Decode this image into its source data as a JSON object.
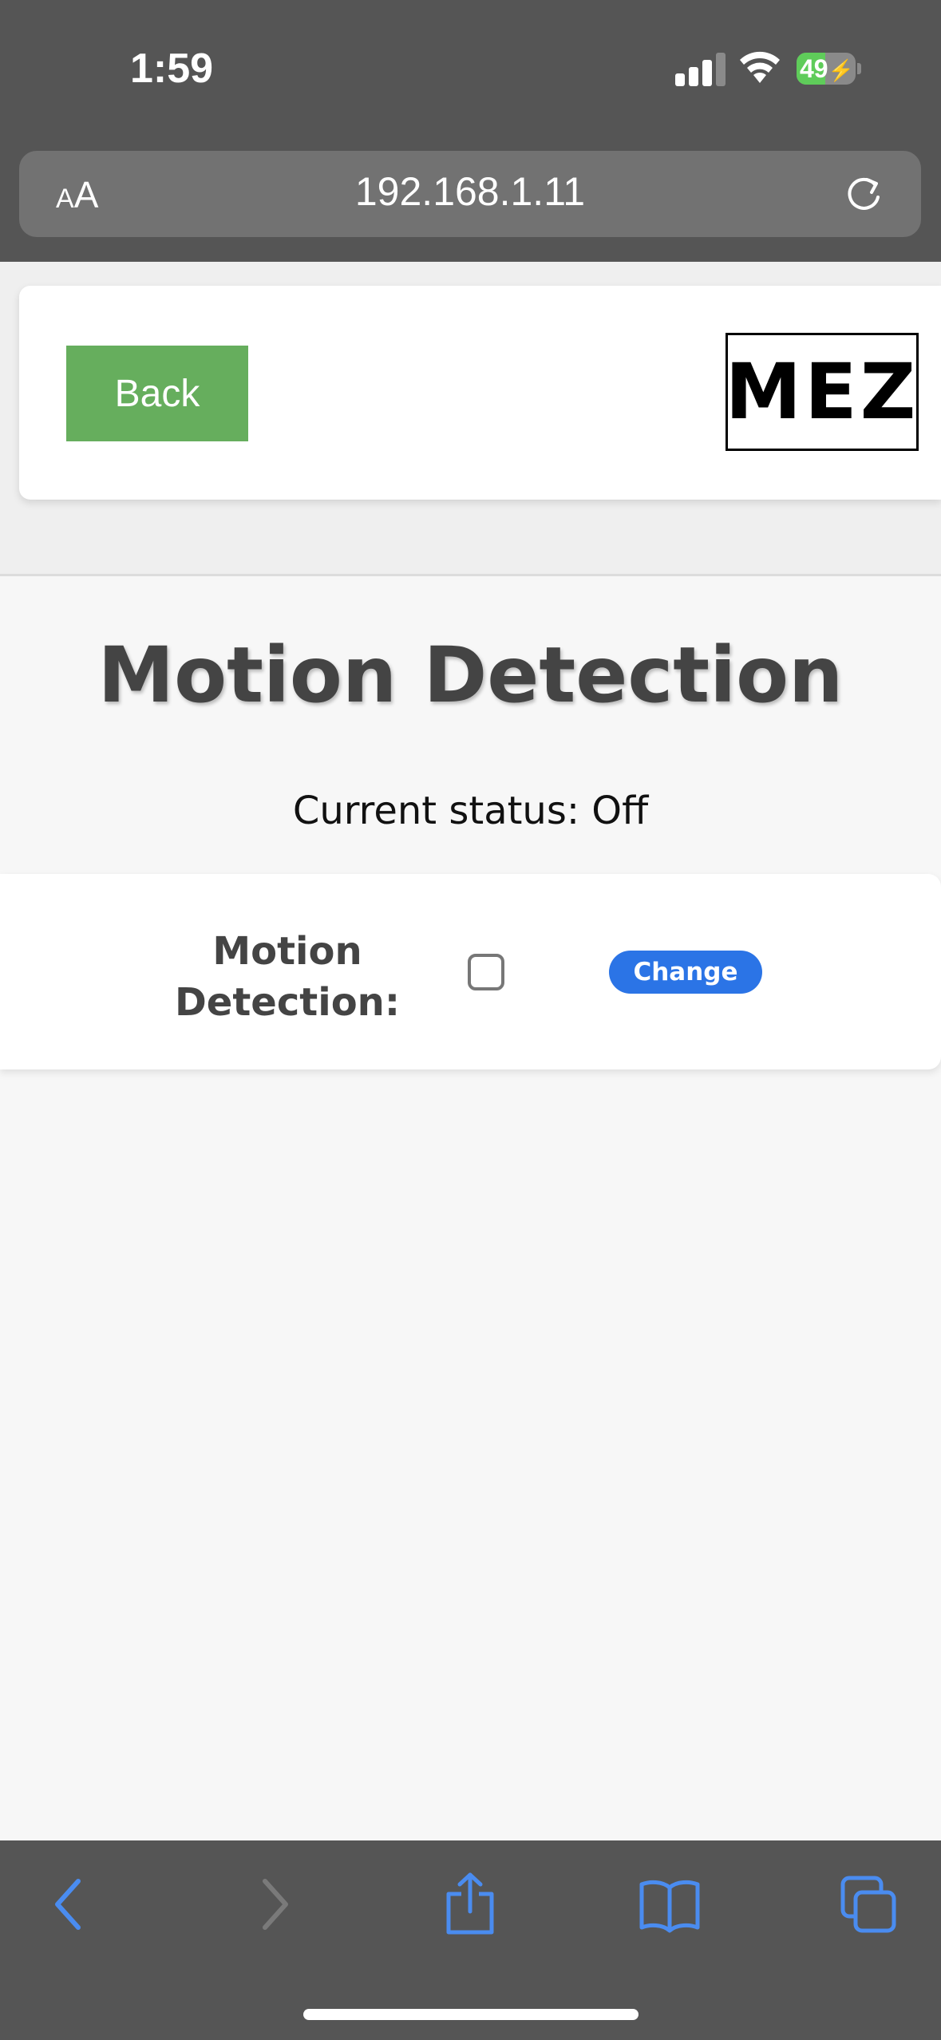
{
  "status_bar": {
    "time": "1:59",
    "battery_level": "49",
    "battery_fraction": 0.49
  },
  "browser": {
    "text_size_label_small": "A",
    "text_size_label_big": "A",
    "url": "192.168.1.11"
  },
  "header": {
    "back_label": "Back",
    "logo_text": "MEZ"
  },
  "main": {
    "title": "Motion Detection",
    "status_label": "Current status:",
    "status_value": "Off",
    "field_label": "Motion Detection:",
    "checkbox_checked": false,
    "change_label": "Change"
  },
  "toolbar": {
    "icons": [
      "back-arrow-icon",
      "forward-arrow-icon",
      "share-icon",
      "bookmarks-icon",
      "tabs-icon"
    ]
  },
  "colors": {
    "chrome": "#555555",
    "back_button": "#66ae5d",
    "change_button": "#2b74e6",
    "toolbar_icon_active": "#4a8cf0",
    "toolbar_icon_disabled": "#7a7a7a"
  }
}
